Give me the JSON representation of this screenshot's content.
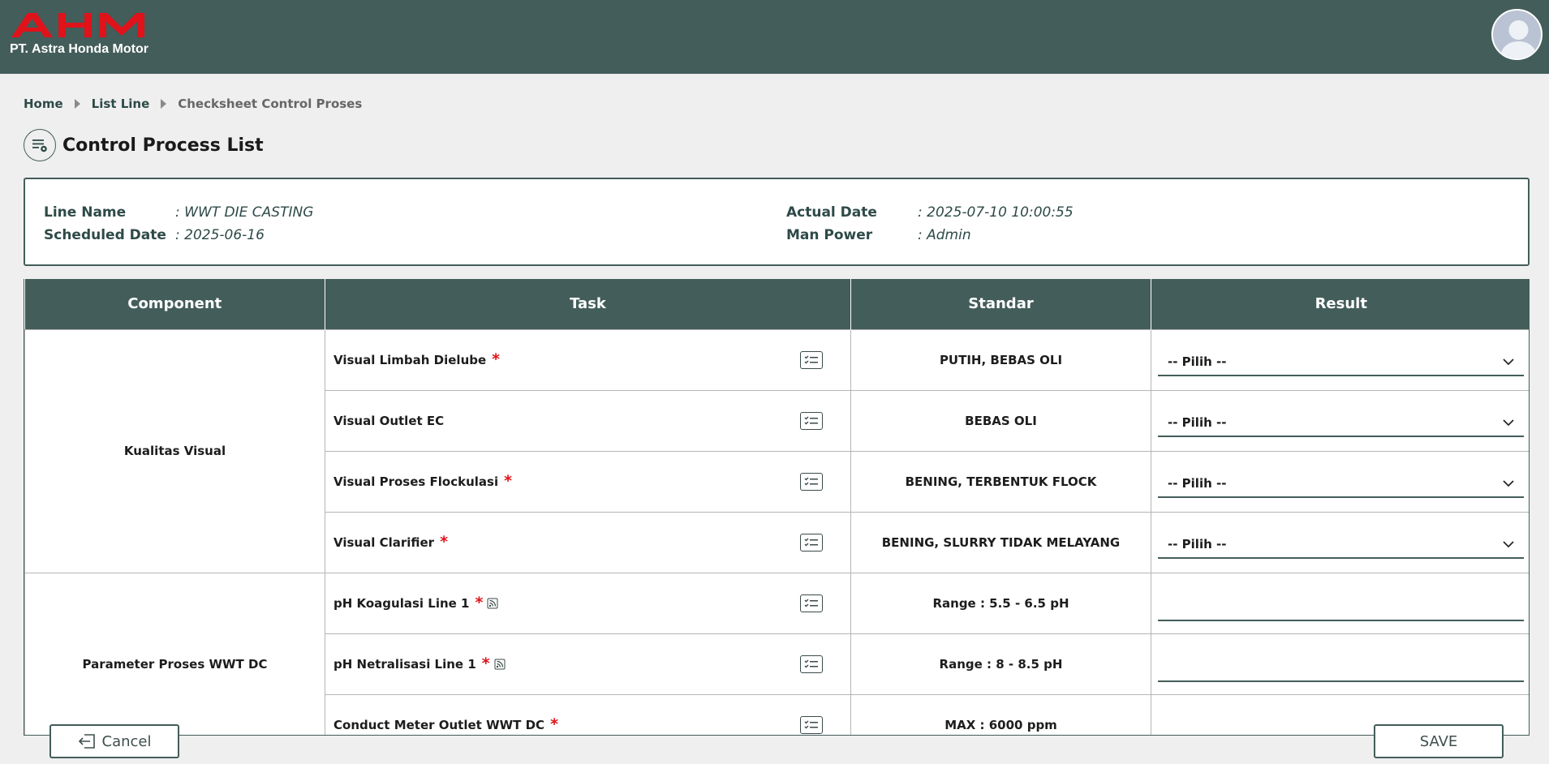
{
  "header": {
    "logo_text": "AHM",
    "company": "PT. Astra Honda Motor"
  },
  "breadcrumb": {
    "home": "Home",
    "list_line": "List Line",
    "current": "Checksheet Control Proses"
  },
  "page": {
    "title": "Control Process List"
  },
  "info": {
    "line_name_label": "Line Name",
    "line_name_value": ": WWT DIE CASTING",
    "scheduled_date_label": "Scheduled Date",
    "scheduled_date_value": ": 2025-06-16",
    "actual_date_label": "Actual Date",
    "actual_date_value": ": 2025-07-10 10:00:55",
    "man_power_label": "Man Power",
    "man_power_value": ": Admin"
  },
  "table": {
    "headers": {
      "component": "Component",
      "task": "Task",
      "standar": "Standar",
      "result": "Result"
    },
    "groups": {
      "kualitas": "Kualitas Visual",
      "parameter": "Parameter Proses WWT DC"
    },
    "rows": [
      {
        "task": "Visual Limbah Dielube",
        "standar": "PUTIH, BEBAS OLI",
        "result": "-- Pilih --"
      },
      {
        "task": "Visual Outlet EC",
        "standar": "BEBAS OLI",
        "result": "-- Pilih --"
      },
      {
        "task": "Visual Proses Flockulasi",
        "standar": "BENING, TERBENTUK FLOCK",
        "result": "-- Pilih --"
      },
      {
        "task": "Visual Clarifier",
        "standar": "BENING, SLURRY TIDAK MELAYANG",
        "result": "-- Pilih --"
      },
      {
        "task": "pH Koagulasi Line 1",
        "standar": "Range : 5.5 - 6.5 pH",
        "result": ""
      },
      {
        "task": "pH Netralisasi Line 1",
        "standar": "Range : 8 - 8.5 pH",
        "result": ""
      },
      {
        "task": "Conduct Meter Outlet WWT DC",
        "standar": "MAX : 6000 ppm",
        "result": ""
      }
    ],
    "required_mark": "*"
  },
  "buttons": {
    "cancel": "Cancel",
    "save": "SAVE"
  },
  "colors": {
    "header_bg": "#435d5a",
    "brand_red": "#e0121a",
    "page_bg": "#efefef"
  }
}
